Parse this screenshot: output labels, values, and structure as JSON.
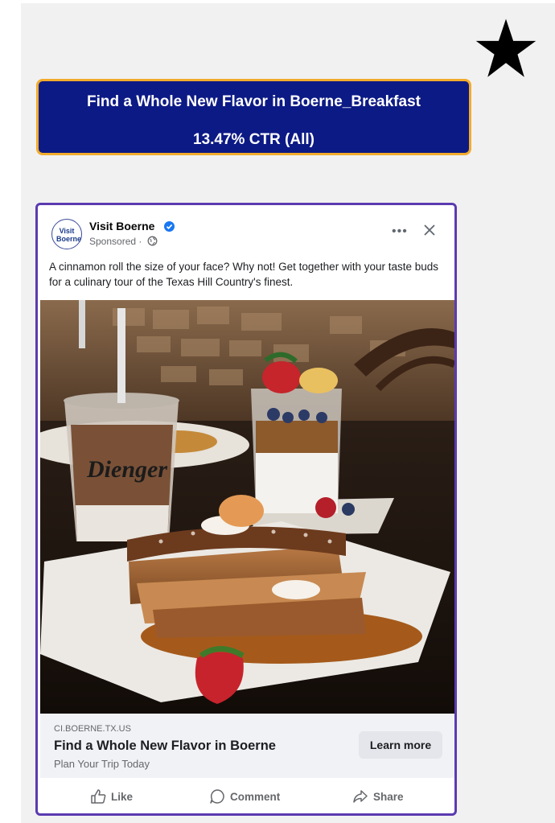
{
  "star_icon": "star-icon",
  "banner": {
    "title": "Find a Whole New Flavor in Boerne_Breakfast",
    "ctr": "13.47% CTR (All)",
    "bg_color": "#0c1a85",
    "border_color": "#f2ac2c"
  },
  "ad": {
    "page_name": "Visit Boerne",
    "avatar_text": "Visit Boerne",
    "sponsored": "Sponsored ·",
    "more_label": "•••",
    "body": "A cinnamon roll the size of your face? Why not! Get together with your taste buds for a culinary tour of the Texas Hill Country's finest.",
    "image_alt": "French toast stack with strawberries and syrup, iced coffee and parfait on a cafe table",
    "cup_text": "Dienger",
    "domain": "CI.BOERNE.TX.US",
    "headline": "Find a Whole New Flavor in Boerne",
    "subhead": "Plan Your Trip Today",
    "cta": "Learn more",
    "border_color": "#5b3bb0"
  },
  "actions": {
    "like": "Like",
    "comment": "Comment",
    "share": "Share"
  }
}
